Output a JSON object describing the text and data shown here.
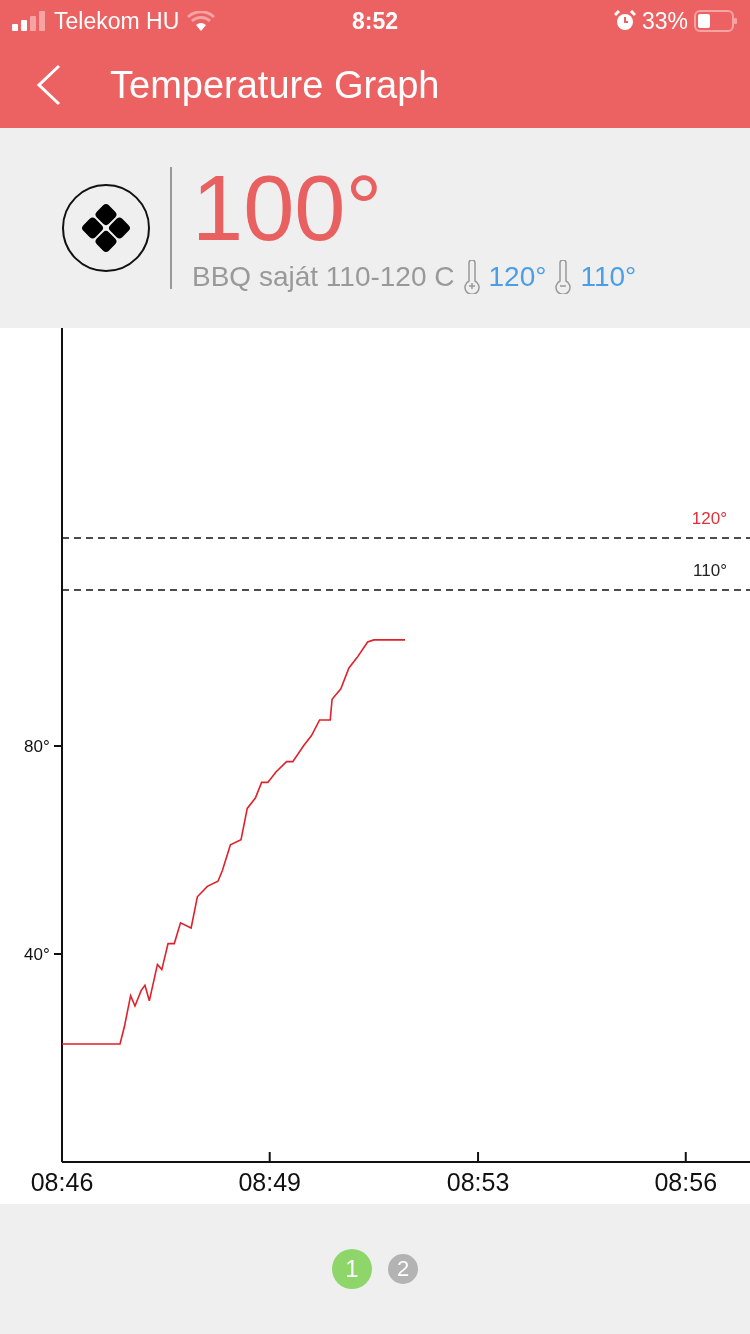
{
  "status_bar": {
    "carrier": "Telekom HU",
    "time": "8:52",
    "battery": "33%"
  },
  "nav": {
    "title": "Temperature Graph"
  },
  "reading": {
    "temperature": "100°",
    "profile": "BBQ saját 110-120 C",
    "high": "120°",
    "low": "110°"
  },
  "chart": {
    "chart_data": {
      "type": "line",
      "x": [
        526,
        526.93,
        527,
        527.1,
        527.17,
        527.27,
        527.33,
        527.4,
        527.53,
        527.6,
        527.7,
        527.8,
        527.9,
        528.07,
        528.17,
        528.33,
        528.5,
        528.57,
        528.7,
        528.87,
        528.97,
        529.1,
        529.2,
        529.3,
        529.43,
        529.6,
        529.7,
        529.87,
        530,
        530.13,
        530.3,
        530.33,
        530.47,
        530.6,
        530.73,
        530.9,
        531,
        531.2,
        531.5
      ],
      "series": [
        {
          "color": "#e0202a",
          "values": [
            22.7,
            22.7,
            26,
            32,
            30,
            33,
            34,
            31,
            38,
            37,
            42,
            42,
            46,
            45,
            51,
            53,
            54,
            56,
            61,
            62,
            68,
            70,
            73,
            73,
            75,
            77,
            77,
            80,
            82,
            85,
            85,
            89,
            91,
            95,
            97,
            100,
            100.4,
            100.4,
            100.4
          ]
        }
      ],
      "xlim": [
        526,
        537.03
      ],
      "ylim": [
        0,
        160
      ],
      "xticks": [
        {
          "value": 526,
          "label": "08:46"
        },
        {
          "value": 529.33,
          "label": "08:49"
        },
        {
          "value": 532.67,
          "label": "08:53"
        },
        {
          "value": 536,
          "label": "08:56"
        }
      ],
      "yticks": [
        {
          "value": 40,
          "label": "40°"
        },
        {
          "value": 80,
          "label": "80°"
        }
      ],
      "ref_lines": [
        {
          "axis": "y",
          "value": 120,
          "label": "120°",
          "color": "#111111"
        },
        {
          "axis": "y",
          "value": 110,
          "label": "110°",
          "color": "#111111"
        }
      ]
    }
  },
  "pages": [
    {
      "label": "1",
      "selected": true
    },
    {
      "label": "2",
      "selected": false
    }
  ]
}
